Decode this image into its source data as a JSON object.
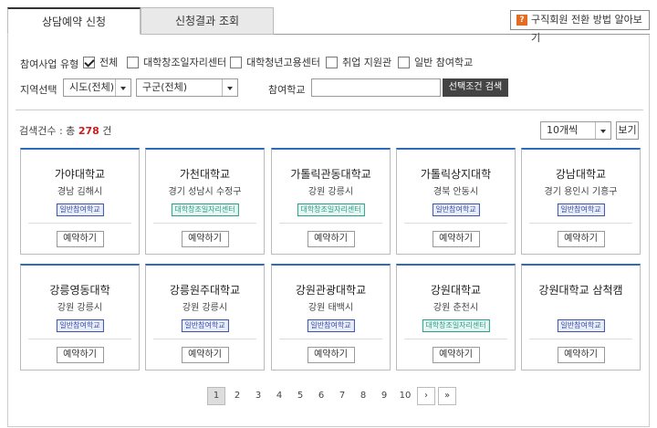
{
  "tabs": [
    {
      "label": "상담예약 신청",
      "active": true
    },
    {
      "label": "신청결과 조회",
      "active": false
    }
  ],
  "help_button": {
    "icon": "question-icon",
    "glyph": "?",
    "label": "구직회원 전환 방법 알아보기"
  },
  "filters": {
    "program_type_label": "참여사업 유형",
    "program_types": [
      {
        "label": "전체",
        "checked": true
      },
      {
        "label": "대학창조일자리센터",
        "checked": false
      },
      {
        "label": "대학청년고용센터",
        "checked": false
      },
      {
        "label": "취업 지원관",
        "checked": false
      },
      {
        "label": "일반 참여학교",
        "checked": false
      }
    ],
    "region_label": "지역선택",
    "city_select": "시도(전체)",
    "district_select": "구군(전체)",
    "school_label": "참여학교",
    "school_input": "",
    "search_button": "선택조건 검색"
  },
  "results": {
    "count_prefix": "검색건수 : 총",
    "count": "278",
    "count_suffix": "건",
    "page_size_select": "10개씩",
    "view_button": "보기"
  },
  "cards": [
    {
      "name": "가야대학교",
      "location": "경남 김해시",
      "badge": "일반참여학교",
      "badge_type": "general",
      "button": "예약하기"
    },
    {
      "name": "가천대학교",
      "location": "경기 성남시 수정구",
      "badge": "대학창조일자리센터",
      "badge_type": "center",
      "button": "예약하기"
    },
    {
      "name": "가톨릭관동대학교",
      "location": "강원 강릉시",
      "badge": "대학창조일자리센터",
      "badge_type": "center",
      "button": "예약하기"
    },
    {
      "name": "가톨릭상지대학",
      "location": "경북 안동시",
      "badge": "일반참여학교",
      "badge_type": "general",
      "button": "예약하기"
    },
    {
      "name": "강남대학교",
      "location": "경기 용인시 기흥구",
      "badge": "일반참여학교",
      "badge_type": "general",
      "button": "예약하기"
    },
    {
      "name": "강릉영동대학",
      "location": "강원 강릉시",
      "badge": "일반참여학교",
      "badge_type": "general",
      "button": "예약하기"
    },
    {
      "name": "강릉원주대학교",
      "location": "강원 강릉시",
      "badge": "일반참여학교",
      "badge_type": "general",
      "button": "예약하기"
    },
    {
      "name": "강원관광대학교",
      "location": "강원 태백시",
      "badge": "일반참여학교",
      "badge_type": "general",
      "button": "예약하기"
    },
    {
      "name": "강원대학교",
      "location": "강원 춘천시",
      "badge": "대학창조일자리센터",
      "badge_type": "center",
      "button": "예약하기"
    },
    {
      "name": "강원대학교 삼척캠",
      "location": "",
      "badge": "일반참여학교",
      "badge_type": "general",
      "button": "예약하기"
    }
  ],
  "pagination": {
    "pages": [
      "1",
      "2",
      "3",
      "4",
      "5",
      "6",
      "7",
      "8",
      "9",
      "10"
    ],
    "current": "1",
    "next": "›",
    "last": "»"
  },
  "colors": {
    "card_top": "#2e6bb8",
    "count_number": "#c81e1e",
    "help_icon": "#e46b1f",
    "search_button": "#444444"
  }
}
